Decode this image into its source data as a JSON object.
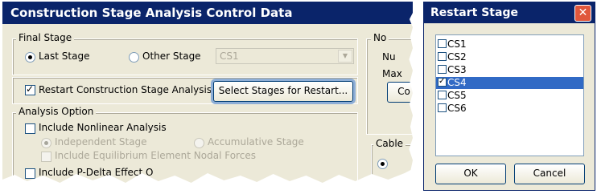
{
  "main_dialog": {
    "title": "Construction Stage Analysis Control Data",
    "final_stage": {
      "legend": "Final Stage",
      "option_last": "Last Stage",
      "option_other": "Other Stage",
      "selected": "Last Stage",
      "stage_combo_value": "CS1"
    },
    "restart": {
      "checkbox_label": "Restart Construction Stage Analysis",
      "checked": true,
      "select_button": "Select Stages for Restart..."
    },
    "analysis_option": {
      "legend": "Analysis Option",
      "nonlinear_label": "Include Nonlinear Analysis",
      "independent_label": "Independent Stage",
      "accumulative_label": "Accumulative Stage",
      "equilibrium_label": "Include Equilibrium Element Nodal Forces",
      "pdelta_label": "Include P-Delta Effect O"
    },
    "right_panel": {
      "legend_partial": "No",
      "line1_partial": "Nu",
      "line2_partial": "Max",
      "button_partial": "Co",
      "cable_legend_partial": "Cable"
    }
  },
  "restart_dialog": {
    "title": "Restart Stage",
    "close_glyph": "✕",
    "stages": [
      {
        "label": "CS1",
        "checked": false,
        "selected": false
      },
      {
        "label": "CS2",
        "checked": false,
        "selected": false
      },
      {
        "label": "CS3",
        "checked": false,
        "selected": false
      },
      {
        "label": "CS4",
        "checked": true,
        "selected": true
      },
      {
        "label": "CS5",
        "checked": false,
        "selected": false
      },
      {
        "label": "CS6",
        "checked": false,
        "selected": false
      }
    ],
    "ok_label": "OK",
    "cancel_label": "Cancel"
  },
  "colors": {
    "title_bar": "#0a246a",
    "dialog_bg": "#ece9d8",
    "selection": "#316ac5",
    "focus_ring": "#8eaed6"
  }
}
